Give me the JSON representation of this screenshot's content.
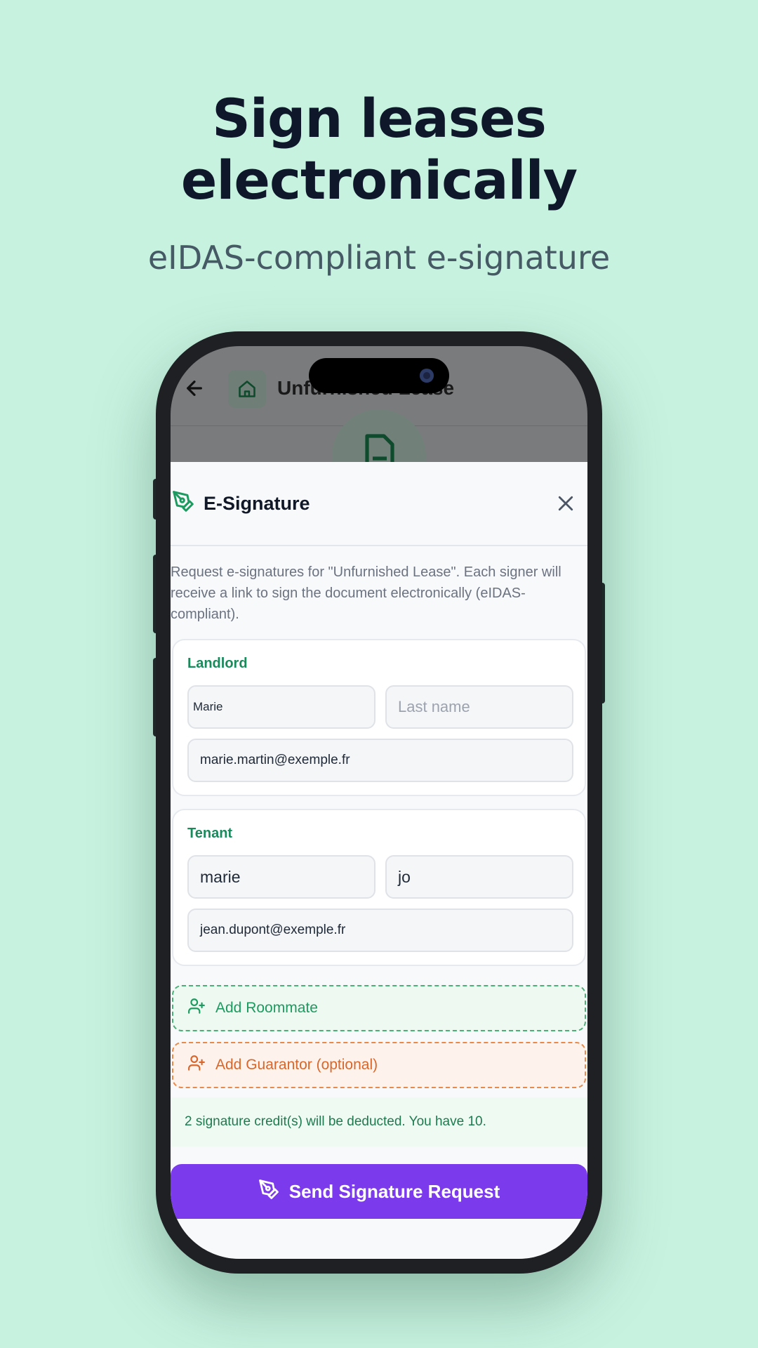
{
  "headline": {
    "line1": "Sign leases",
    "line2": "electronically"
  },
  "subheadline": "eIDAS-compliant e-signature",
  "app": {
    "title": "Unfurnished Lease",
    "back_icon": "arrow-left-icon",
    "home_icon": "home-icon",
    "document_icon": "file-signature-icon"
  },
  "sheet": {
    "title": "E-Signature",
    "title_icon": "pen-tool-icon",
    "close_icon": "close-icon",
    "description": "Request e-signatures for \"Unfurnished Lease\". Each signer will receive a link to sign the document electronically (eIDAS-compliant).",
    "landlord": {
      "label": "Landlord",
      "first_name": "Marie",
      "last_name_placeholder": "Last name",
      "email": "marie.martin@exemple.fr"
    },
    "tenant": {
      "label": "Tenant",
      "first_name": "marie",
      "last_name": "jo",
      "email": "jean.dupont@exemple.fr"
    },
    "add_roommate": {
      "label": "Add Roommate",
      "icon": "user-plus-icon"
    },
    "add_guarantor": {
      "label": "Add Guarantor (optional)",
      "icon": "user-plus-icon"
    },
    "credits_notice": "2 signature credit(s) will be deducted. You have 10.",
    "send_button": {
      "label": "Send Signature Request",
      "icon": "pen-tool-icon"
    }
  },
  "colors": {
    "background": "#c8f2e0",
    "accent_green": "#1a8a5c",
    "accent_orange": "#d9662a",
    "primary_button": "#7c3aed"
  }
}
